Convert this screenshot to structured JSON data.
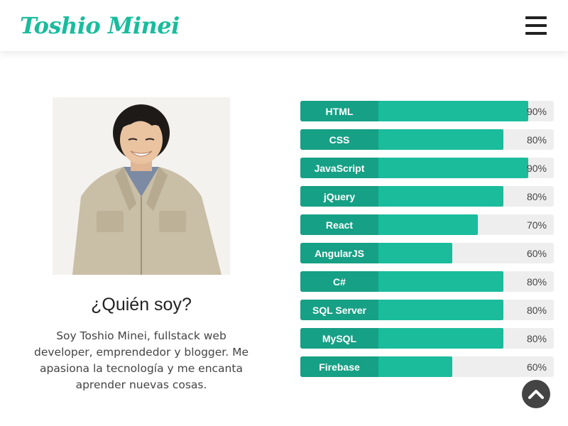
{
  "header": {
    "logo": "Toshio Minei",
    "menu_icon": "hamburger-icon"
  },
  "about": {
    "photo_icon": "profile-photo",
    "title": "¿Quién soy?",
    "text": "Soy Toshio Minei, fullstack web developer, emprendedor y blogger. Me apasiona la tecnología y me encanta aprender nuevas cosas."
  },
  "skills": [
    {
      "label": "HTML",
      "percent": 90,
      "percent_label": "90%"
    },
    {
      "label": "CSS",
      "percent": 80,
      "percent_label": "80%"
    },
    {
      "label": "JavaScript",
      "percent": 90,
      "percent_label": "90%"
    },
    {
      "label": "jQuery",
      "percent": 80,
      "percent_label": "80%"
    },
    {
      "label": "React",
      "percent": 70,
      "percent_label": "70%"
    },
    {
      "label": "AngularJS",
      "percent": 60,
      "percent_label": "60%"
    },
    {
      "label": "C#",
      "percent": 80,
      "percent_label": "80%"
    },
    {
      "label": "SQL Server",
      "percent": 80,
      "percent_label": "80%"
    },
    {
      "label": "MySQL",
      "percent": 80,
      "percent_label": "80%"
    },
    {
      "label": "Firebase",
      "percent": 60,
      "percent_label": "60%"
    }
  ],
  "scroll_top": {
    "icon": "chevron-up-icon"
  },
  "colors": {
    "accent": "#1abc9c",
    "accent_dark": "#16a085",
    "track": "#eeeeee"
  }
}
